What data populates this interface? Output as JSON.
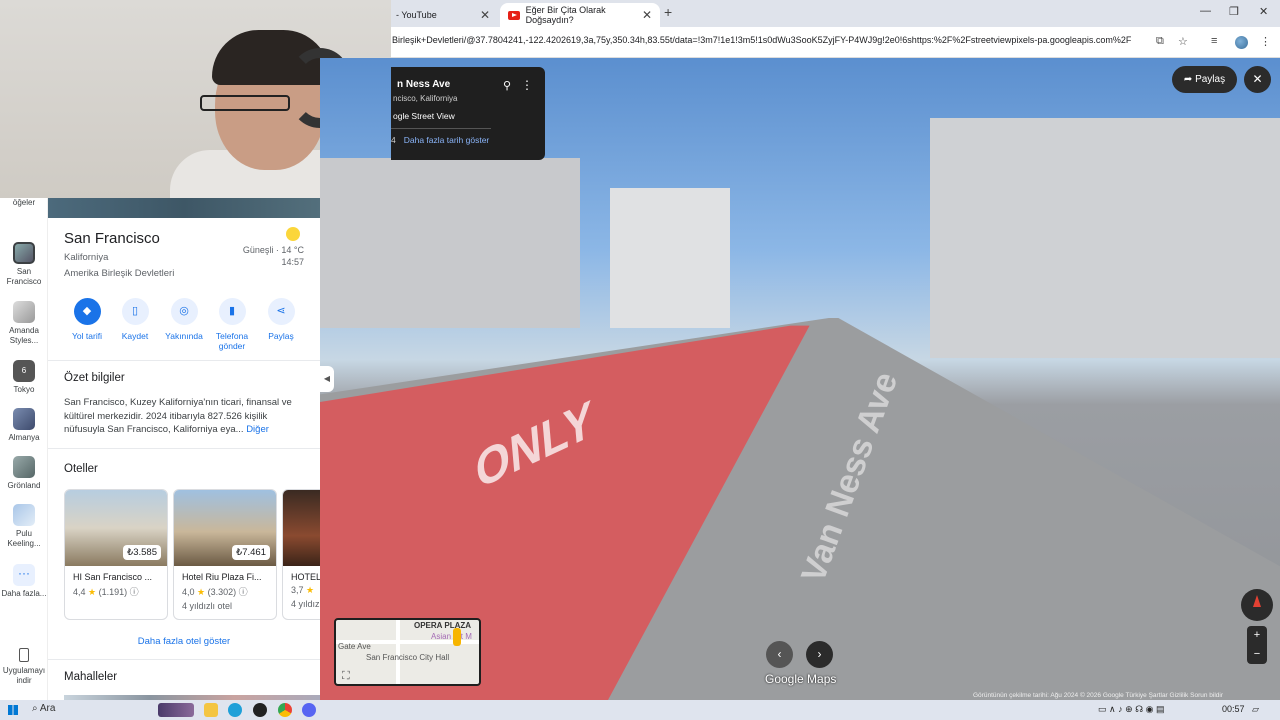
{
  "browser": {
    "tabs": [
      {
        "label": "- YouTube"
      },
      {
        "label": "Eğer Bir Çita Olarak Doğsaydın?"
      }
    ],
    "url": "Birleşik+Devletleri/@37.7804241,-122.4202619,3a,75y,350.34h,83.55t/data=!3m7!1e1!3m5!1s0dWu3SooK5ZyjFY-P4WJ9g!2e0!6shttps:%2F%2Fstreetviewpixels-pa.googleapis.com%2F"
  },
  "rail": {
    "top_label": "öğeler",
    "items": [
      {
        "label": "San Francisco"
      },
      {
        "label": "Amanda Styles..."
      },
      {
        "label": "Tokyo",
        "badge": "6"
      },
      {
        "label": "Almanya"
      },
      {
        "label": "Grönland"
      },
      {
        "label": "Pulu Keeling..."
      },
      {
        "label": "Daha fazla..."
      }
    ],
    "app_label": "Uygulamayı indir"
  },
  "place": {
    "name": "San Francisco",
    "region": "Kaliforniya",
    "country": "Amerika Birleşik Devletleri",
    "weather": "Güneşli · 14 °C",
    "time": "14:57"
  },
  "actions": [
    {
      "label": "Yol tarifi",
      "icon": "directions-icon"
    },
    {
      "label": "Kaydet",
      "icon": "bookmark-icon"
    },
    {
      "label": "Yakınında",
      "icon": "nearby-icon"
    },
    {
      "label": "Telefona gönder",
      "icon": "phone-icon"
    },
    {
      "label": "Paylaş",
      "icon": "share-icon"
    }
  ],
  "summary": {
    "title": "Özet bilgiler",
    "text": "San Francisco, Kuzey Kaliforniya'nın ticari, finansal ve kültürel merkezidir. 2024 itibarıyla 827.526 kişilik nüfusuyla San Francisco, Kaliforniya eya...",
    "more": "Diğer"
  },
  "hotels": {
    "title": "Oteller",
    "items": [
      {
        "name": "HI San Francisco ...",
        "price": "₺3.585",
        "rating": "4,4",
        "reviews": "(1.191)",
        "extra": ""
      },
      {
        "name": "Hotel Riu Plaza Fi...",
        "price": "₺7.461",
        "rating": "4,0",
        "reviews": "(3.302)",
        "extra": "4 yıldızlı otel"
      },
      {
        "name": "HOTEL",
        "price": "",
        "rating": "3,7",
        "reviews": "",
        "extra": "4 yıldız"
      }
    ],
    "more": "Daha fazla otel göster"
  },
  "neighborhoods": {
    "title": "Mahalleler"
  },
  "streetview": {
    "street": "n Ness Ave",
    "city": "ncisco, Kaliforniya",
    "source": "ogle Street View",
    "date_num": "4",
    "date_link": "Daha fazla tarih göster",
    "road_text": "ONLY",
    "paint_name": "Van Ness Ave",
    "share": "Paylaş",
    "logo": "Google Maps",
    "credits": "Görüntünün çekilme tarihi: Ağu 2024   © 2026 Google   Türkiye   Şartlar   Gizlilik   Sorun bildir"
  },
  "minimap": {
    "labels": [
      "OPERA PLAZA",
      "Asian Art M",
      "Gate Ave",
      "San Francisco City Hall"
    ]
  },
  "taskbar": {
    "search": "Ara",
    "time": "00:57"
  },
  "colors": {
    "accent": "#1a73e8",
    "bus_lane": "#d45d60"
  }
}
